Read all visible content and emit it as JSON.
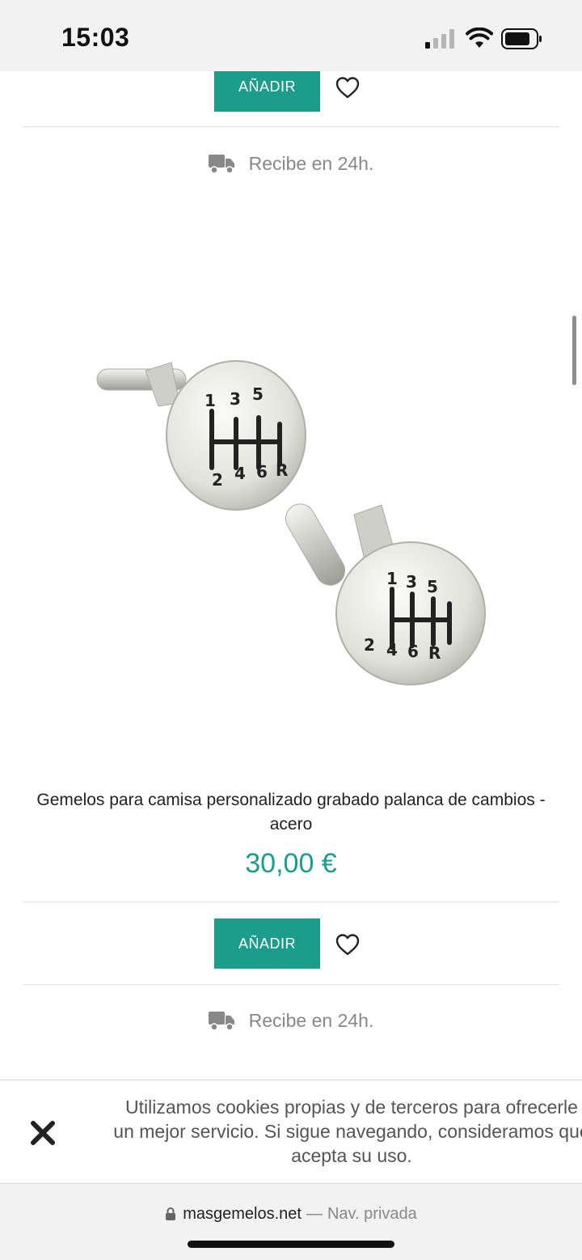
{
  "status_bar": {
    "time": "15:03"
  },
  "product_prev": {
    "add_label": "AÑADIR",
    "delivery_text": "Recibe en 24h."
  },
  "product": {
    "title": "Gemelos para camisa personalizado grabado palanca de cambios - acero",
    "price": "30,00 €",
    "add_label": "AÑADIR",
    "delivery_text": "Recibe en 24h.",
    "engraving": {
      "top": [
        "1",
        "3",
        "5"
      ],
      "bottom": [
        "2",
        "4",
        "6",
        "R"
      ]
    }
  },
  "cookie_banner": {
    "text": "Utilizamos cookies propias y de terceros para ofrecerle un mejor servicio. Si sigue navegando, consideramos que acepta su uso."
  },
  "browser": {
    "domain": "masgemelos.net",
    "separator": "—",
    "mode": "Nav. privada"
  },
  "colors": {
    "accent": "#1a9e8b",
    "muted": "#888888"
  }
}
